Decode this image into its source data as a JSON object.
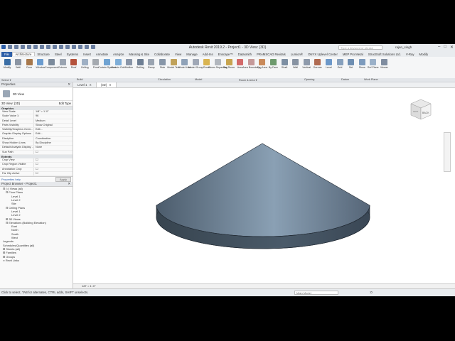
{
  "app": {
    "title": "Autodesk Revit 2019.2 - Project1 - 3D View: {3D}",
    "search_placeholder": "Type a keyword or phrase",
    "user": "rajan_singh",
    "window_controls": [
      "–",
      "□",
      "✕"
    ]
  },
  "ribbon": {
    "tabs": [
      "File",
      "Architecture",
      "Structure",
      "Steel",
      "Systems",
      "Insert",
      "Annotate",
      "Analyze",
      "Massing & Site",
      "Collaborate",
      "View",
      "Manage",
      "Add-Ins",
      "Enscape™",
      "Datasmith",
      "PRAMSCAD Revitals",
      "Lumion®",
      "ONYX Uplevel Center",
      "MEP Pro Metal",
      "StructSoft Solutions Ltd.",
      "V-Ray",
      "Modify"
    ],
    "active_tab": "Architecture",
    "buttons": [
      {
        "label": "Modify",
        "color": "#3a6ea5"
      },
      {
        "label": "Wall",
        "color": "#8b95a3"
      },
      {
        "label": "Door",
        "color": "#a7784b"
      },
      {
        "label": "Window",
        "color": "#6b9ccf"
      },
      {
        "label": "Component",
        "color": "#7c8b9c"
      },
      {
        "label": "Column",
        "color": "#9aa4b1"
      },
      {
        "label": "Roof",
        "color": "#b5523c"
      },
      {
        "label": "Ceiling",
        "color": "#9fb0c4"
      },
      {
        "label": "Floor",
        "color": "#a5aab0"
      },
      {
        "label": "Curtain System",
        "color": "#6fa3d2"
      },
      {
        "label": "Curtain Grid",
        "color": "#7eaed8"
      },
      {
        "label": "Mullion",
        "color": "#8a96a8"
      },
      {
        "label": "Railing",
        "color": "#6e7f94"
      },
      {
        "label": "Ramp",
        "color": "#9aa4b1"
      },
      {
        "label": "Stair",
        "color": "#8796a8"
      },
      {
        "label": "Model Text",
        "color": "#c0a25a"
      },
      {
        "label": "Model Line",
        "color": "#8fa2b8"
      },
      {
        "label": "Model Group",
        "color": "#a0a8b6"
      },
      {
        "label": "Room",
        "color": "#d9b451"
      },
      {
        "label": "Room Separator",
        "color": "#b2b7be"
      },
      {
        "label": "Tag Room",
        "color": "#c7a44f"
      },
      {
        "label": "Area",
        "color": "#d36a6a"
      },
      {
        "label": "Area Boundary",
        "color": "#c59a9a"
      },
      {
        "label": "Tag Area",
        "color": "#c98a5a"
      },
      {
        "label": "By Face",
        "color": "#6d9a6d"
      },
      {
        "label": "Shaft",
        "color": "#7d8fa3"
      },
      {
        "label": "Wall",
        "color": "#8793a2"
      },
      {
        "label": "Vertical",
        "color": "#8e9aab"
      },
      {
        "label": "Dormer",
        "color": "#b06b52"
      },
      {
        "label": "Level",
        "color": "#6c98c9"
      },
      {
        "label": "Grid",
        "color": "#86a0bd"
      },
      {
        "label": "Set",
        "color": "#6e8eb2"
      },
      {
        "label": "Show",
        "color": "#7d9bbd"
      },
      {
        "label": "Ref Plane",
        "color": "#9ab0c8"
      },
      {
        "label": "Viewer",
        "color": "#7f8da0"
      }
    ],
    "panels": [
      "Select ▾",
      "Build",
      "Circulation",
      "Model",
      "Room & Area ▾",
      "Opening",
      "Datum",
      "Work Plane"
    ]
  },
  "properties": {
    "title": "Properties",
    "close": "✕",
    "type_name": "3D View",
    "selector": "3D View: {3D}",
    "edit_type": "Edit Type",
    "groups": [
      {
        "name": "Graphics",
        "rows": [
          {
            "k": "View Scale",
            "v": "1/8\" = 1'-0\""
          },
          {
            "k": "Scale Value  1:",
            "v": "96"
          },
          {
            "k": "Detail Level",
            "v": "Medium"
          },
          {
            "k": "Parts Visibility",
            "v": "Show Original"
          },
          {
            "k": "Visibility/Graphics Overr...",
            "v": "Edit..."
          },
          {
            "k": "Graphic Display Options",
            "v": "Edit..."
          },
          {
            "k": "Discipline",
            "v": "Coordination"
          },
          {
            "k": "Show Hidden Lines",
            "v": "By Discipline"
          },
          {
            "k": "Default Analysis Display ...",
            "v": "None"
          },
          {
            "k": "Sun Path",
            "v": "☐"
          }
        ]
      },
      {
        "name": "Extents",
        "rows": [
          {
            "k": "Crop View",
            "v": "☐"
          },
          {
            "k": "Crop Region Visible",
            "v": "☐"
          },
          {
            "k": "Annotation Crop",
            "v": "☐"
          },
          {
            "k": "Far Clip Active",
            "v": "☐"
          }
        ]
      }
    ],
    "help_link": "Properties help",
    "apply": "Apply"
  },
  "browser": {
    "title": "Project Browser - Project1",
    "close": "✕",
    "items": [
      {
        "label": "⊟ [○] Views (all)",
        "indent": 1
      },
      {
        "label": "⊟ Floor Plans",
        "indent": 2
      },
      {
        "label": "Level 1",
        "indent": 4
      },
      {
        "label": "Level 2",
        "indent": 4
      },
      {
        "label": "Site",
        "indent": 4
      },
      {
        "label": "⊟ Ceiling Plans",
        "indent": 2
      },
      {
        "label": "Level 1",
        "indent": 4
      },
      {
        "label": "Level 2",
        "indent": 4
      },
      {
        "label": "⊞ 3D Views",
        "indent": 2
      },
      {
        "label": "⊟ Elevations (Building Elevation)",
        "indent": 2
      },
      {
        "label": "East",
        "indent": 4
      },
      {
        "label": "North",
        "indent": 4
      },
      {
        "label": "South",
        "indent": 4
      },
      {
        "label": "West",
        "indent": 4
      },
      {
        "label": "Legends",
        "indent": 1
      },
      {
        "label": "Schedules/Quantities (all)",
        "indent": 1
      },
      {
        "label": "⊞ Sheets (all)",
        "indent": 1
      },
      {
        "label": "⊞ Families",
        "indent": 1
      },
      {
        "label": "⊞ Groups",
        "indent": 1
      },
      {
        "label": "∞ Revit Links",
        "indent": 1
      }
    ]
  },
  "view_tabs": [
    {
      "label": "Level 1",
      "close": "✕",
      "active": false
    },
    {
      "label": "{3D}",
      "close": "✕",
      "active": true
    }
  ],
  "viewcube": {
    "face": "BACK",
    "label_front": "LEFT"
  },
  "view_control": {
    "scale": "1/8\" = 1'-0\""
  },
  "status": {
    "text": "Click to select, TAB for alternates, CTRL adds, SHIFT unselects.",
    "model_field": "Main Model",
    "zoom": ":0"
  },
  "colors": {
    "shape_dark": "#3a4856",
    "shape_light": "#8fa5ba",
    "accent": "#2d5fa8"
  }
}
